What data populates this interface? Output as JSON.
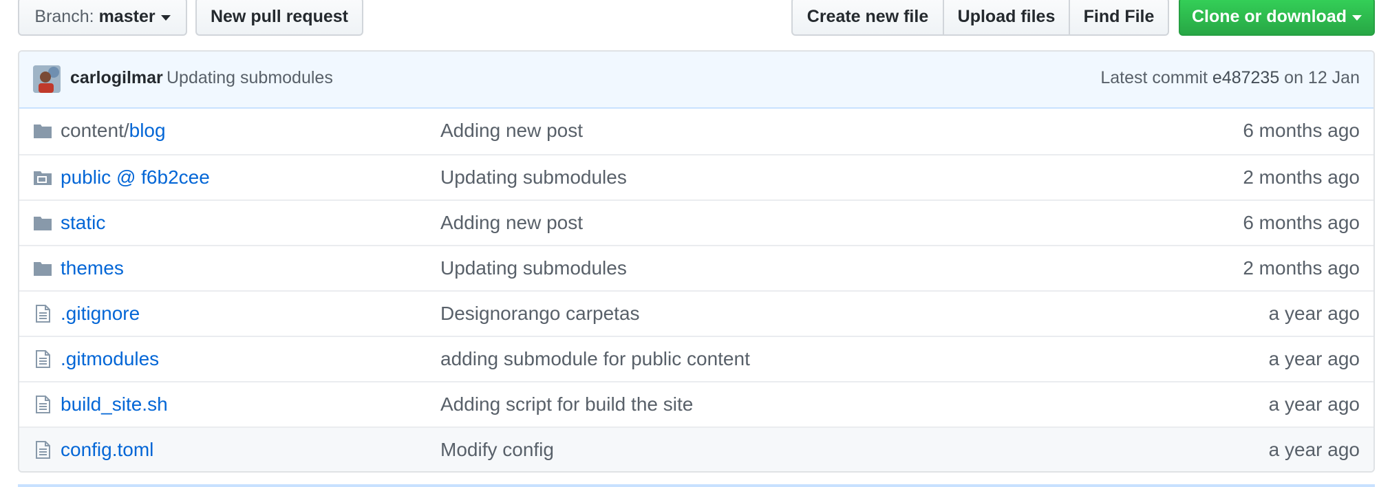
{
  "toolbar": {
    "branch_prefix": "Branch:",
    "branch_name": "master",
    "new_pull_request": "New pull request",
    "create_new_file": "Create new file",
    "upload_files": "Upload files",
    "find_file": "Find File",
    "clone_or_download": "Clone or download"
  },
  "commit": {
    "author": "carlogilmar",
    "message": "Updating submodules",
    "latest_label": "Latest commit",
    "sha": "e487235",
    "date": "on 12 Jan"
  },
  "files": [
    {
      "type": "directory",
      "prefix": "content/",
      "name": "blog",
      "message": "Adding new post",
      "age": "6 months ago"
    },
    {
      "type": "submodule",
      "prefix": "",
      "name": "public @ f6b2cee",
      "message": "Updating submodules",
      "age": "2 months ago"
    },
    {
      "type": "directory",
      "prefix": "",
      "name": "static",
      "message": "Adding new post",
      "age": "6 months ago"
    },
    {
      "type": "directory",
      "prefix": "",
      "name": "themes",
      "message": "Updating submodules",
      "age": "2 months ago"
    },
    {
      "type": "file",
      "prefix": "",
      "name": ".gitignore",
      "message": "Designorango carpetas",
      "age": "a year ago"
    },
    {
      "type": "file",
      "prefix": "",
      "name": ".gitmodules",
      "message": "adding submodule for public content",
      "age": "a year ago"
    },
    {
      "type": "file",
      "prefix": "",
      "name": "build_site.sh",
      "message": "Adding script for build the site",
      "age": "a year ago"
    },
    {
      "type": "file",
      "prefix": "",
      "name": "config.toml",
      "message": "Modify config",
      "age": "a year ago"
    }
  ],
  "colors": {
    "link": "#0366d6",
    "muted": "#586069",
    "primary_button": "#28a745",
    "commit_bar": "#f1f8ff",
    "folder_icon": "#79b8ff"
  }
}
